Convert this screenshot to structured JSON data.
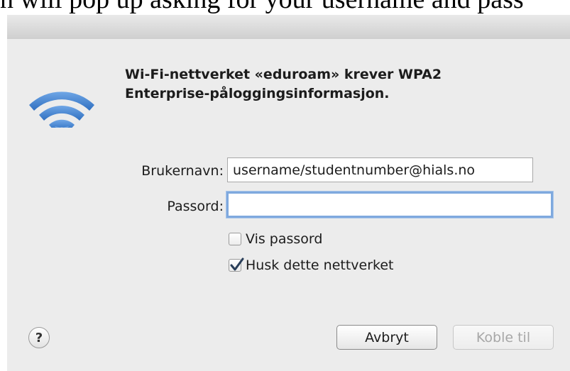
{
  "caption": {
    "text": "n will pop up asking for your username and pass"
  },
  "dialog": {
    "heading_line1": "Wi-Fi-nettverket «eduroam» krever WPA2",
    "heading_line2": "Enterprise-påloggingsinformasjon.",
    "username": {
      "label": "Brukernavn:",
      "value": "username/studentnumber@hials.no"
    },
    "password": {
      "label": "Passord:",
      "value": ""
    },
    "show_password": {
      "label": "Vis passord",
      "checked": false
    },
    "remember_network": {
      "label": "Husk dette nettverket",
      "checked": true
    },
    "help_label": "?",
    "cancel_label": "Avbryt",
    "connect_label": "Koble til"
  },
  "colors": {
    "wifi_icon": "#3f7fd0",
    "focus_ring": "#7fa9de",
    "checkmark": "#2a3f5a"
  }
}
